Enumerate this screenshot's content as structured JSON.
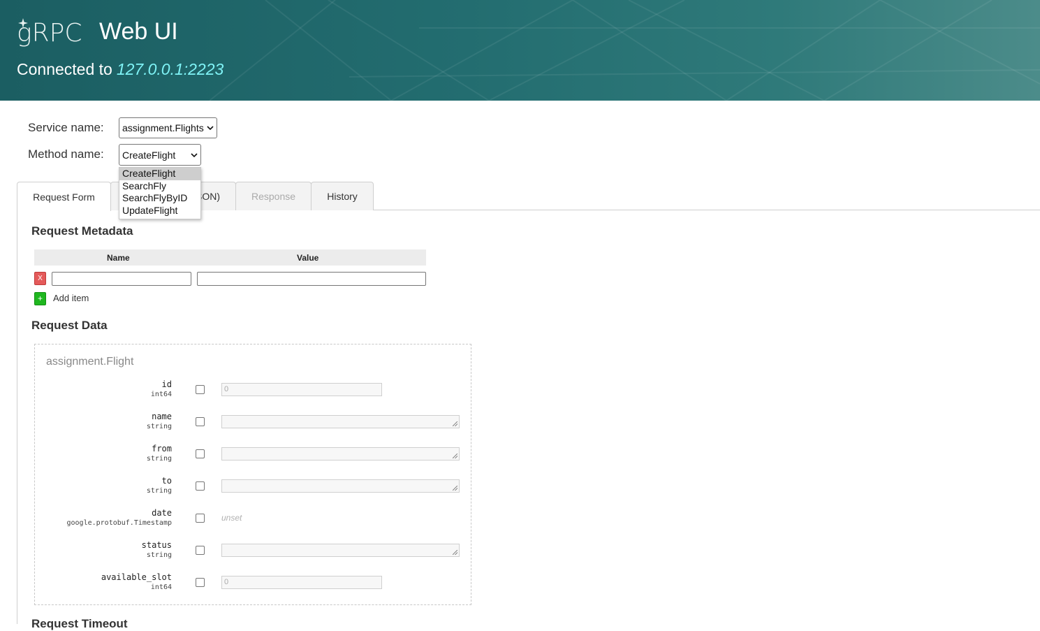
{
  "header": {
    "logo_text": "gRPC",
    "title": "Web UI",
    "connected_label": "Connected to",
    "address": "127.0.0.1:2223"
  },
  "service": {
    "label": "Service name:",
    "value": "assignment.Flights"
  },
  "method": {
    "label": "Method name:",
    "value": "CreateFlight",
    "options": [
      "CreateFlight",
      "SearchFly",
      "SearchFlyByID",
      "UpdateFlight"
    ]
  },
  "tabs": [
    {
      "label": "Request Form",
      "state": "active"
    },
    {
      "label": "Raw Request (JSON)",
      "visible_fragment": "SON)",
      "state": "normal"
    },
    {
      "label": "Response",
      "state": "disabled"
    },
    {
      "label": "History",
      "state": "normal"
    }
  ],
  "metadata": {
    "title": "Request Metadata",
    "col_name": "Name",
    "col_value": "Value",
    "remove_label": "X",
    "add_icon": "+",
    "add_label": "Add item"
  },
  "request_data": {
    "title": "Request Data",
    "message_name": "assignment.Flight",
    "fields": [
      {
        "name": "id",
        "type": "int64",
        "placeholder": "0"
      },
      {
        "name": "name",
        "type": "string",
        "placeholder": ""
      },
      {
        "name": "from",
        "type": "string",
        "placeholder": ""
      },
      {
        "name": "to",
        "type": "string",
        "placeholder": ""
      },
      {
        "name": "date",
        "type": "google.protobuf.Timestamp",
        "placeholder": "unset"
      },
      {
        "name": "status",
        "type": "string",
        "placeholder": ""
      },
      {
        "name": "available_slot",
        "type": "int64",
        "placeholder": "0"
      }
    ]
  },
  "request_timeout": {
    "title": "Request Timeout"
  },
  "colors": {
    "header_start": "#1b5e62",
    "header_end": "#4c8c8a",
    "address": "#7ff3f6",
    "remove_button": "#e45a5a",
    "add_button": "#1fb71f"
  }
}
